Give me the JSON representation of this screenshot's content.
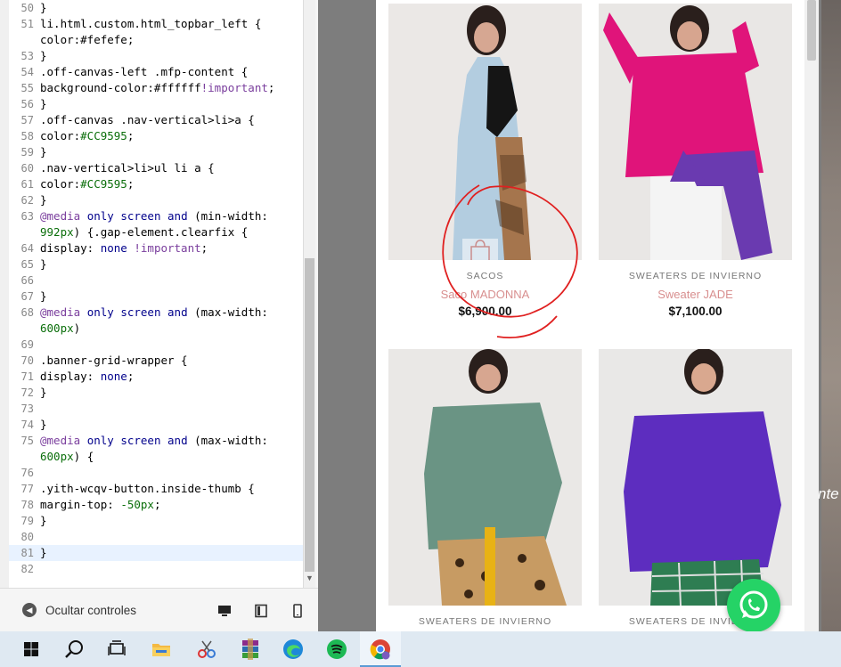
{
  "editor": {
    "lines": [
      {
        "n": "50",
        "t": "}"
      },
      {
        "n": "51",
        "t": "li.html.custom.html_topbar_left {"
      },
      {
        "n": "",
        "t": "color:#fefefe;"
      },
      {
        "n": "53",
        "t": "}"
      },
      {
        "n": "54",
        "t": ".off-canvas-left .mfp-content {"
      },
      {
        "n": "55",
        "t": "background-color:#ffffff!important;"
      },
      {
        "n": "56",
        "t": "}"
      },
      {
        "n": "57",
        "t": ".off-canvas .nav-vertical>li>a {"
      },
      {
        "n": "58",
        "t": "color:#CC9595;"
      },
      {
        "n": "59",
        "t": "}"
      },
      {
        "n": "60",
        "t": ".nav-vertical>li>ul li a {"
      },
      {
        "n": "61",
        "t": "color:#CC9595;"
      },
      {
        "n": "62",
        "t": "}"
      },
      {
        "n": "63",
        "t": "@media only screen and (min-width:"
      },
      {
        "n": "",
        "t": "992px) {.gap-element.clearfix {"
      },
      {
        "n": "64",
        "t": "display: none !important;"
      },
      {
        "n": "65",
        "t": "}"
      },
      {
        "n": "66",
        "t": ""
      },
      {
        "n": "67",
        "t": "}"
      },
      {
        "n": "68",
        "t": "@media only screen and (max-width:"
      },
      {
        "n": "",
        "t": "600px)"
      },
      {
        "n": "69",
        "t": ""
      },
      {
        "n": "70",
        "t": ".banner-grid-wrapper {"
      },
      {
        "n": "71",
        "t": "display: none;"
      },
      {
        "n": "72",
        "t": "}"
      },
      {
        "n": "73",
        "t": ""
      },
      {
        "n": "74",
        "t": "}"
      },
      {
        "n": "75",
        "t": "@media only screen and (max-width:"
      },
      {
        "n": "",
        "t": "600px) {"
      },
      {
        "n": "76",
        "t": ""
      },
      {
        "n": "77",
        "t": ".yith-wcqv-button.inside-thumb {"
      },
      {
        "n": "78",
        "t": "margin-top: -50px;"
      },
      {
        "n": "79",
        "t": "}"
      },
      {
        "n": "80",
        "t": ""
      },
      {
        "n": "81",
        "t": "}"
      },
      {
        "n": "82",
        "t": ""
      }
    ]
  },
  "controls": {
    "hide_label": "Ocultar controles"
  },
  "store": {
    "products": [
      {
        "category": "SACOS",
        "name": "Saco MADONNA",
        "price": "$6,900.00"
      },
      {
        "category": "SWEATERS DE INVIERNO",
        "name": "Sweater JADE",
        "price": "$7,100.00"
      },
      {
        "category": "SWEATERS DE INVIERNO",
        "name": "",
        "price": ""
      },
      {
        "category": "SWEATERS DE INVIERNO",
        "name": "",
        "price": ""
      }
    ]
  },
  "background": {
    "partial_text": "nte"
  },
  "colors": {
    "accent": "#CC9595",
    "whatsapp": "#25D366",
    "annotation": "#E02020"
  },
  "taskbar": {
    "icons": [
      "windows-start-icon",
      "search-icon",
      "task-view-icon",
      "file-explorer-icon",
      "snipping-tool-icon",
      "winrar-icon",
      "edge-icon",
      "spotify-icon",
      "chrome-icon"
    ]
  }
}
